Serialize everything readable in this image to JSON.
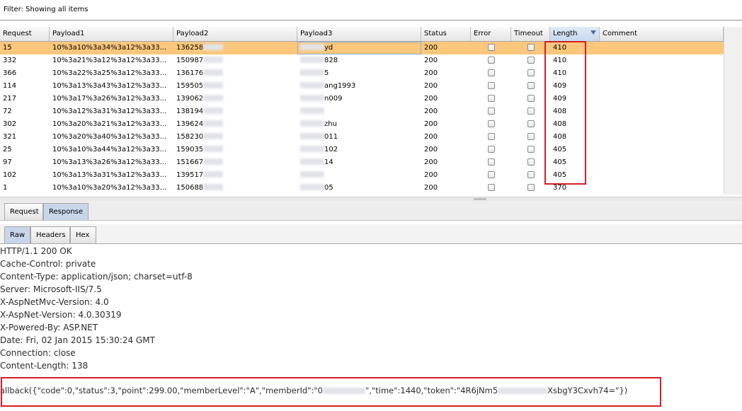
{
  "filter": {
    "text": "Filter:  Showing all items"
  },
  "table": {
    "columns": [
      "Request",
      "Payload1",
      "Payload2",
      "Payload3",
      "Status",
      "Error",
      "Timeout",
      "Length",
      "Comment"
    ],
    "sorted_column": "Length",
    "rows": [
      {
        "request": "15",
        "payload1": "10%3a10%3a34%3a12%3a33...",
        "payload2": "136258",
        "payload3": "yd",
        "status": "200",
        "length": "410",
        "selected": true
      },
      {
        "request": "332",
        "payload1": "10%3a21%3a12%3a12%3a33...",
        "payload2": "150987",
        "payload3": "828",
        "status": "200",
        "length": "410"
      },
      {
        "request": "366",
        "payload1": "10%3a22%3a25%3a12%3a33...",
        "payload2": "136176",
        "payload3": "5",
        "status": "200",
        "length": "410"
      },
      {
        "request": "114",
        "payload1": "10%3a13%3a43%3a12%3a33...",
        "payload2": "159505",
        "payload3": "ang1993",
        "status": "200",
        "length": "409"
      },
      {
        "request": "217",
        "payload1": "10%3a17%3a26%3a12%3a33...",
        "payload2": "139062",
        "payload3": "n009",
        "status": "200",
        "length": "409"
      },
      {
        "request": "72",
        "payload1": "10%3a12%3a31%3a12%3a33...",
        "payload2": "138194",
        "payload3": "",
        "status": "200",
        "length": "408"
      },
      {
        "request": "302",
        "payload1": "10%3a20%3a21%3a12%3a33...",
        "payload2": "139624",
        "payload3": "zhu",
        "status": "200",
        "length": "408"
      },
      {
        "request": "321",
        "payload1": "10%3a20%3a40%3a12%3a33...",
        "payload2": "158230",
        "payload3": "011",
        "status": "200",
        "length": "408"
      },
      {
        "request": "25",
        "payload1": "10%3a10%3a44%3a12%3a33...",
        "payload2": "159035",
        "payload3": "102",
        "status": "200",
        "length": "405"
      },
      {
        "request": "97",
        "payload1": "10%3a13%3a26%3a12%3a33...",
        "payload2": "151667",
        "payload3": "14",
        "status": "200",
        "length": "405"
      },
      {
        "request": "102",
        "payload1": "10%3a13%3a31%3a12%3a33...",
        "payload2": "139517",
        "payload3": "",
        "status": "200",
        "length": "405"
      },
      {
        "request": "1",
        "payload1": "10%3a10%3a20%3a12%3a33...",
        "payload2": "150688",
        "payload3": "05",
        "status": "200",
        "length": "370"
      }
    ]
  },
  "viewer_tabs": [
    "Request",
    "Response"
  ],
  "active_viewer_tab": "Response",
  "format_tabs": [
    "Raw",
    "Headers",
    "Hex"
  ],
  "active_format_tab": "Raw",
  "response": {
    "lines": [
      "HTTP/1.1 200 OK",
      "Cache-Control: private",
      "Content-Type: application/json; charset=utf-8",
      "Server: Microsoft-IIS/7.5",
      "X-AspNetMvc-Version: 4.0",
      "X-AspNet-Version: 4.0.30319",
      "X-Powered-By: ASP.NET",
      "Date: Fri, 02 Jan 2015 15:30:24 GMT",
      "Connection: close",
      "Content-Length: 138"
    ],
    "body_part1": "allback({\"code\":0,\"status\":3,\"point\":299.00,\"memberLevel\":\"A\",\"memberId\":\"0",
    "body_part2": "\",\"time\":1440,\"token\":\"4R6jNm5",
    "body_part3": "XsbgY3Cxvh74=\"})"
  },
  "colors": {
    "selected_row": "#fbc77c",
    "highlight_box": "#d21f26",
    "active_tab": "#c8d6ea"
  }
}
